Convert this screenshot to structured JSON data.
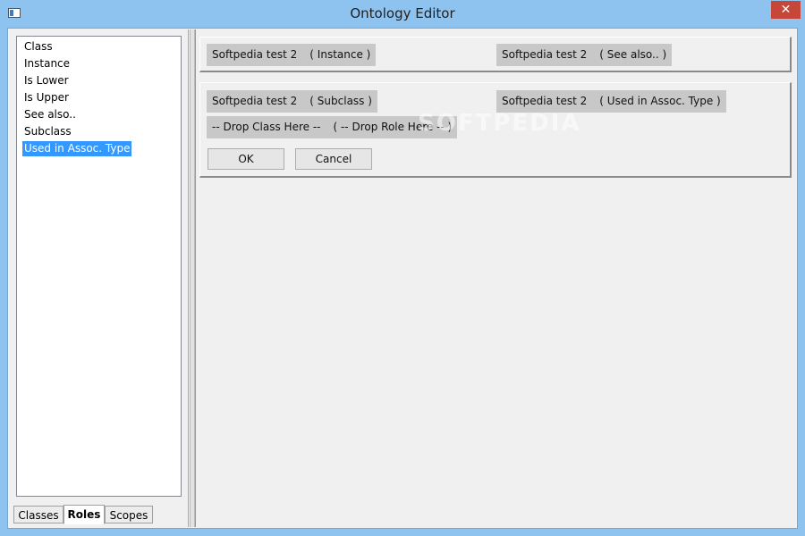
{
  "window": {
    "title": "Ontology Editor"
  },
  "titlebar": {
    "close_glyph": "✕"
  },
  "sidebar": {
    "items": [
      {
        "label": "Class"
      },
      {
        "label": "Instance"
      },
      {
        "label": "Is Lower"
      },
      {
        "label": "Is Upper"
      },
      {
        "label": "See also.."
      },
      {
        "label": "Subclass"
      },
      {
        "label": "Used in Assoc. Type",
        "selected": true
      }
    ],
    "tabs": [
      {
        "label": "Classes"
      },
      {
        "label": "Roles",
        "active": true
      },
      {
        "label": "Scopes"
      }
    ]
  },
  "top_panel": {
    "chip1": {
      "name": "Softpedia test 2",
      "role": "( Instance )"
    },
    "chip2": {
      "name": "Softpedia test 2",
      "role": "( See also.. )"
    }
  },
  "edit_panel": {
    "chip1": {
      "name": "Softpedia test 2",
      "role": "( Subclass )"
    },
    "chip2": {
      "name": "Softpedia test 2",
      "role": "( Used in Assoc. Type )"
    },
    "drop_chip": {
      "class_text": "-- Drop Class Here --",
      "role_text": "( -- Drop Role Here -- )"
    },
    "ok_label": "OK",
    "cancel_label": "Cancel"
  },
  "watermark": "SOFTPEDIA",
  "colors": {
    "selection": "#3399ff",
    "chip": "#c8c8c8",
    "titlebar": "#8ec2ef",
    "close": "#c7463a"
  },
  "icons": {
    "app": "window-app-icon",
    "close": "close-icon"
  }
}
